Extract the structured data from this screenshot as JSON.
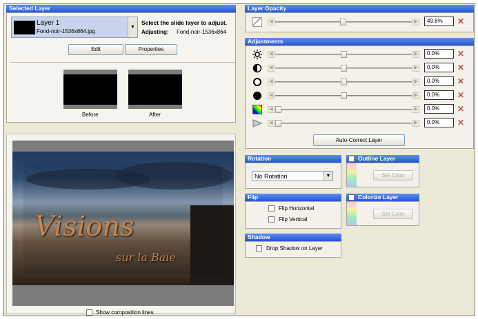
{
  "selected_layer": {
    "header": "Selected Layer",
    "layer_name": "Layer  1",
    "layer_file": "Fond-noir-1536x864.jpg",
    "instruction": "Select the slide layer to adjust.",
    "adjusting_label": "Adjusting:",
    "adjusting_value": "Fond-noir-1536x864",
    "edit_label": "Edit",
    "properties_label": "Properties",
    "before_label": "Before",
    "after_label": "After"
  },
  "preview": {
    "title_text": "Visions",
    "subtitle_text": "sur la Baie",
    "show_composition_label": "Show composition lines"
  },
  "opacity": {
    "header": "Layer Opacity",
    "value": "49.8%",
    "level": 0.498
  },
  "adjustments": {
    "header": "Adjustments",
    "rows": [
      {
        "icon": "brightness-icon",
        "value": "0.0%",
        "level": 0.5
      },
      {
        "icon": "contrast-icon",
        "value": "0.0%",
        "level": 0.5
      },
      {
        "icon": "white-point-icon",
        "value": "0.0%",
        "level": 0.5
      },
      {
        "icon": "black-point-icon",
        "value": "0.0%",
        "level": 0.5
      },
      {
        "icon": "hue-icon",
        "value": "0.0%",
        "level": 0.0
      },
      {
        "icon": "sharpen-icon",
        "value": "0.0%",
        "level": 0.0
      }
    ],
    "auto_correct_label": "Auto-Correct Layer"
  },
  "rotation": {
    "header": "Rotation",
    "selected": "No Rotation"
  },
  "outline": {
    "header": "Outline Layer",
    "set_color_label": "Set Color"
  },
  "flip": {
    "header": "Flip",
    "horizontal_label": "Flip Horizontal",
    "vertical_label": "Flip Vertical"
  },
  "colorize": {
    "header": "Colorize Layer",
    "set_color_label": "Set Color"
  },
  "shadow": {
    "header": "Shadow",
    "drop_shadow_label": "Drop Shadow on Layer"
  },
  "colors": {
    "header_blue": "#2f62d8",
    "panel_bg": "#ece9d8",
    "title_orange": "#d8925a"
  }
}
